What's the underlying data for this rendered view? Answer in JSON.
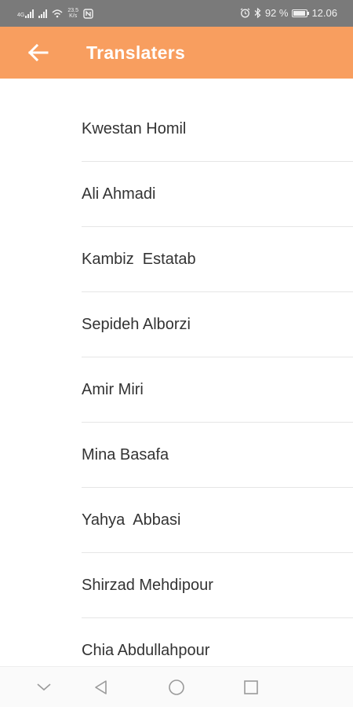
{
  "status_bar": {
    "network_left": "4G",
    "speed_value": "23.5",
    "speed_unit": "K/s",
    "battery_percent": "92 %",
    "battery_level": 0.92,
    "time": "12.06"
  },
  "app_bar": {
    "title": "Translaters",
    "background": "#f89e5f"
  },
  "translators": [
    "Kwestan Homil",
    "Ali Ahmadi",
    "Kambiz  Estatab",
    "Sepideh Alborzi",
    "Amir Miri",
    "Mina Basafa",
    "Yahya  Abbasi",
    "Shirzad Mehdipour",
    "Chia Abdullahpour"
  ],
  "icons": {
    "back": "arrow-left-icon",
    "nav_hide": "chevron-down-icon",
    "nav_back": "triangle-back-icon",
    "nav_home": "circle-home-icon",
    "nav_recents": "square-recents-icon"
  }
}
